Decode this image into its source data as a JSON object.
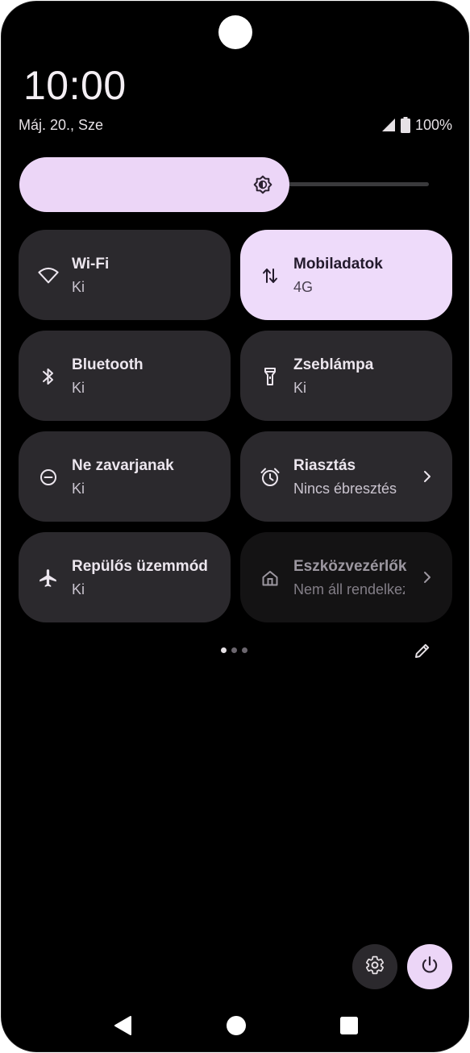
{
  "status": {
    "time": "10:00",
    "date": "Máj. 20., Sze",
    "battery": "100%",
    "signal_icon": "cell-signal-icon",
    "battery_icon": "battery-full-icon"
  },
  "brightness": {
    "level_fraction": 0.66,
    "icon": "brightness-auto-icon"
  },
  "tiles": [
    {
      "title": "Wi-Fi",
      "subtitle": "Ki",
      "icon": "wifi-icon",
      "state": "off"
    },
    {
      "title": "Mobiladatok",
      "subtitle": "4G",
      "icon": "mobile-data-icon",
      "state": "on"
    },
    {
      "title": "Bluetooth",
      "subtitle": "Ki",
      "icon": "bluetooth-icon",
      "state": "off"
    },
    {
      "title": "Zseblámpa",
      "subtitle": "Ki",
      "icon": "flashlight-icon",
      "state": "off"
    },
    {
      "title": "Ne zavarjanak",
      "subtitle": "Ki",
      "icon": "do-not-disturb-icon",
      "state": "off"
    },
    {
      "title": "Riasztás",
      "subtitle": "Nincs ébresztés",
      "icon": "alarm-icon",
      "state": "off"
    },
    {
      "title": "Repülős üzemmód",
      "subtitle": "Ki",
      "icon": "airplane-icon",
      "state": "off"
    },
    {
      "title": "Eszközvezérlők",
      "subtitle": "Nem áll rendelkezésre",
      "icon": "home-icon",
      "state": "unavailable"
    }
  ],
  "pager": {
    "pages": 3,
    "current": 1
  },
  "colors": {
    "accent": "#ecd6f7",
    "tile_bg": "#2b292d",
    "background": "#000000"
  }
}
